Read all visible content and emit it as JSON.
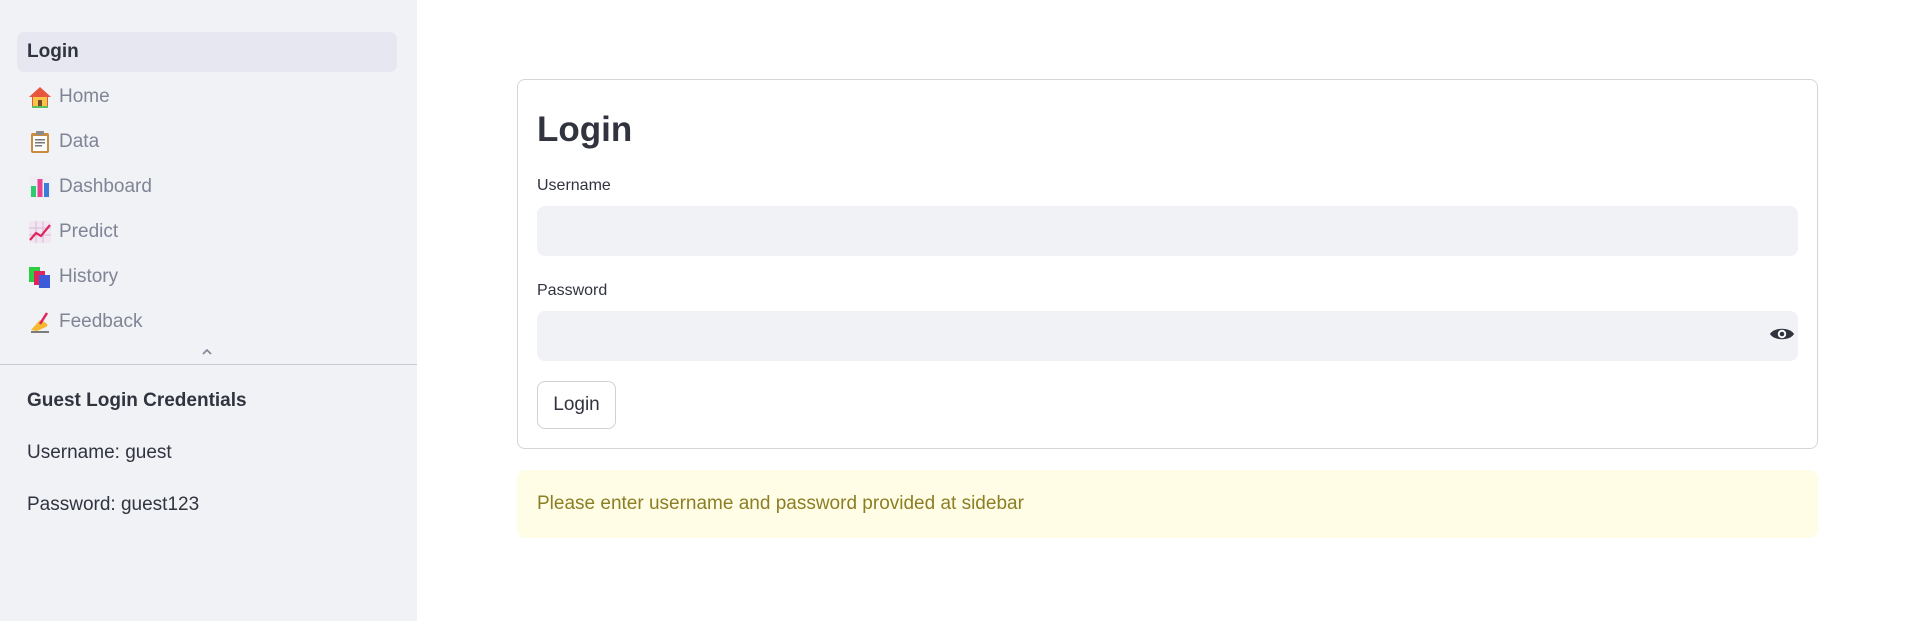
{
  "sidebar": {
    "nav_items": [
      {
        "label": "Login",
        "icon": ""
      },
      {
        "label": "Home",
        "icon": "house-icon"
      },
      {
        "label": "Data",
        "icon": "clipboard-icon"
      },
      {
        "label": "Dashboard",
        "icon": "bar-chart-icon"
      },
      {
        "label": "Predict",
        "icon": "trend-chart-icon"
      },
      {
        "label": "History",
        "icon": "books-icon"
      },
      {
        "label": "Feedback",
        "icon": "writing-hand-icon"
      }
    ],
    "active_index": 0,
    "guest": {
      "title": "Guest Login Credentials",
      "username_line": "Username: guest",
      "password_line": "Password: guest123"
    }
  },
  "form": {
    "title": "Login",
    "username_label": "Username",
    "username_value": "",
    "password_label": "Password",
    "password_value": "",
    "submit_label": "Login"
  },
  "alert": {
    "message": "Please enter username and password provided at sidebar"
  },
  "colors": {
    "sidebar_bg": "#f0f2f6",
    "active_nav_bg": "#e6e7f0",
    "alert_bg": "#fffde6",
    "alert_text": "#8b7e24"
  }
}
